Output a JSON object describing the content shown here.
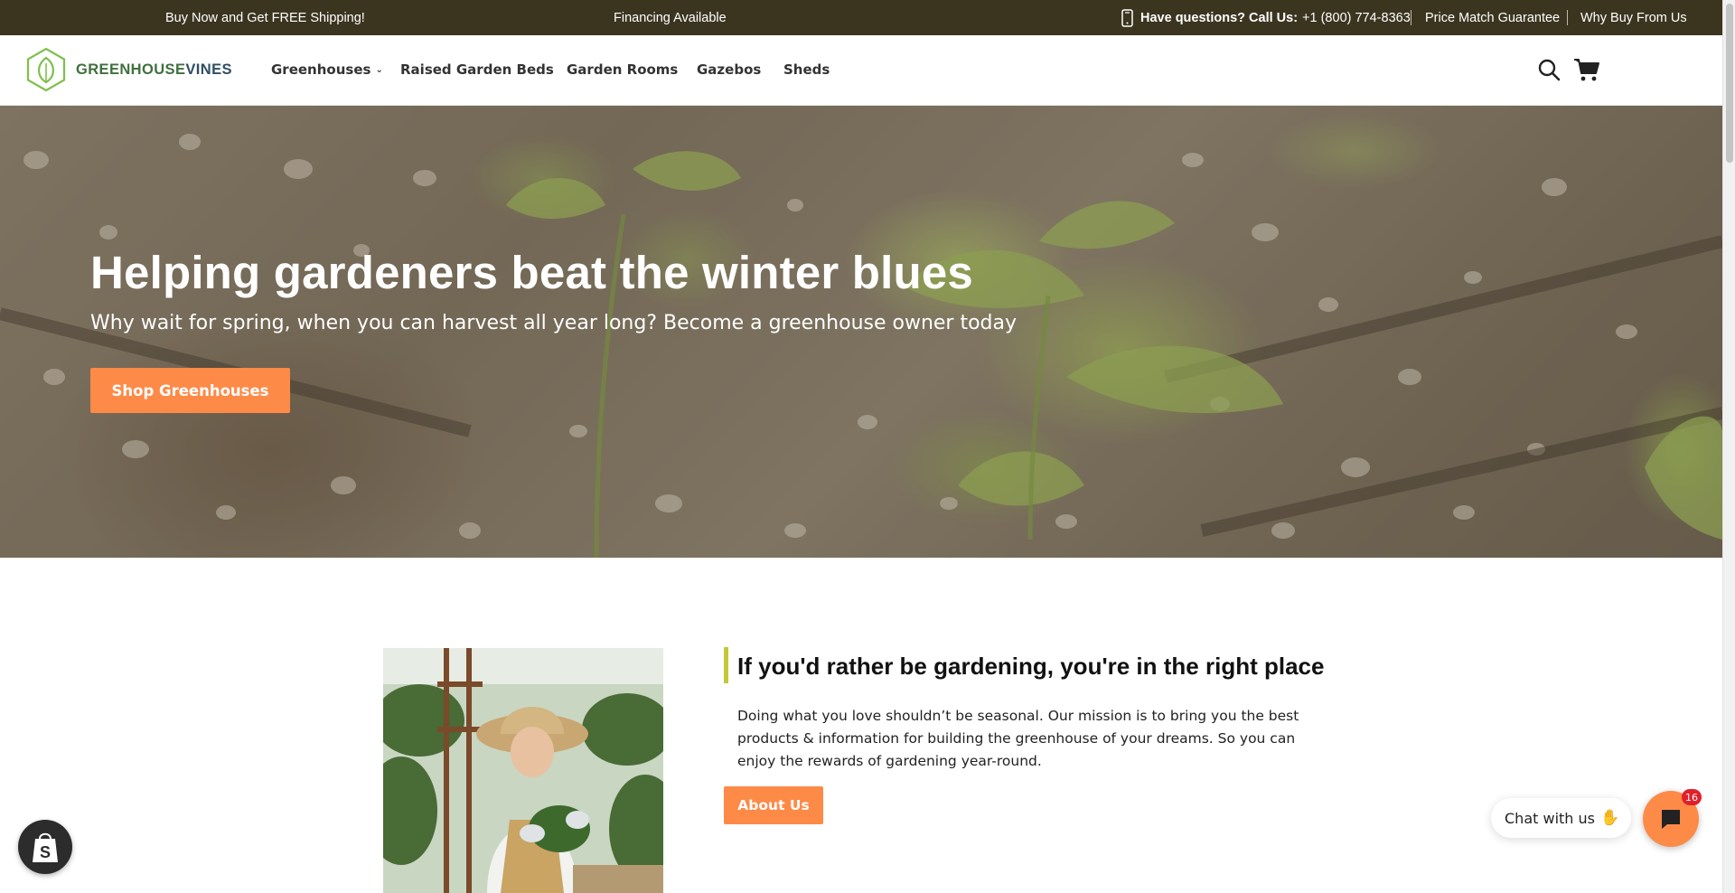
{
  "topbar": {
    "shipping": "Buy Now and Get FREE Shipping!",
    "financing": "Financing Available",
    "call_label": "Have questions? Call Us:",
    "phone": "+1 (800) 774-8363",
    "price_match": "Price Match Guarantee",
    "why_buy": "Why Buy From Us",
    "bg_color": "#3b3520"
  },
  "header": {
    "logo_text_a": "GREENHOUSE",
    "logo_text_b": "VINES",
    "nav": [
      {
        "label": "Greenhouses",
        "icon": "chevron-down-icon"
      },
      {
        "label": "Raised Garden Beds"
      },
      {
        "label": "Garden Rooms"
      },
      {
        "label": "Gazebos"
      },
      {
        "label": "Sheds"
      }
    ],
    "icons": [
      "search-icon",
      "cart-icon"
    ]
  },
  "hero": {
    "title": "Helping gardeners beat the winter blues",
    "subtitle": "Why wait for spring, when you can harvest all year long? Become a greenhouse owner today",
    "cta_label": "Shop Greenhouses"
  },
  "intro": {
    "title": "If you'd rather be gardening, you're in the right place",
    "body": "Doing what you love shouldn’t be seasonal. Our mission is to bring you the best products & information for building the greenhouse of your dreams. So you can enjoy the rewards of gardening year-round.",
    "button_label": "About Us",
    "accent_color": "#c2c836"
  },
  "widgets": {
    "chat_label": "Chat with us",
    "chat_badge": "16",
    "shopify_icon": "shopify-bag-icon"
  },
  "colors": {
    "button": "#fe8a48",
    "brand_green": "#3f6f3e"
  }
}
